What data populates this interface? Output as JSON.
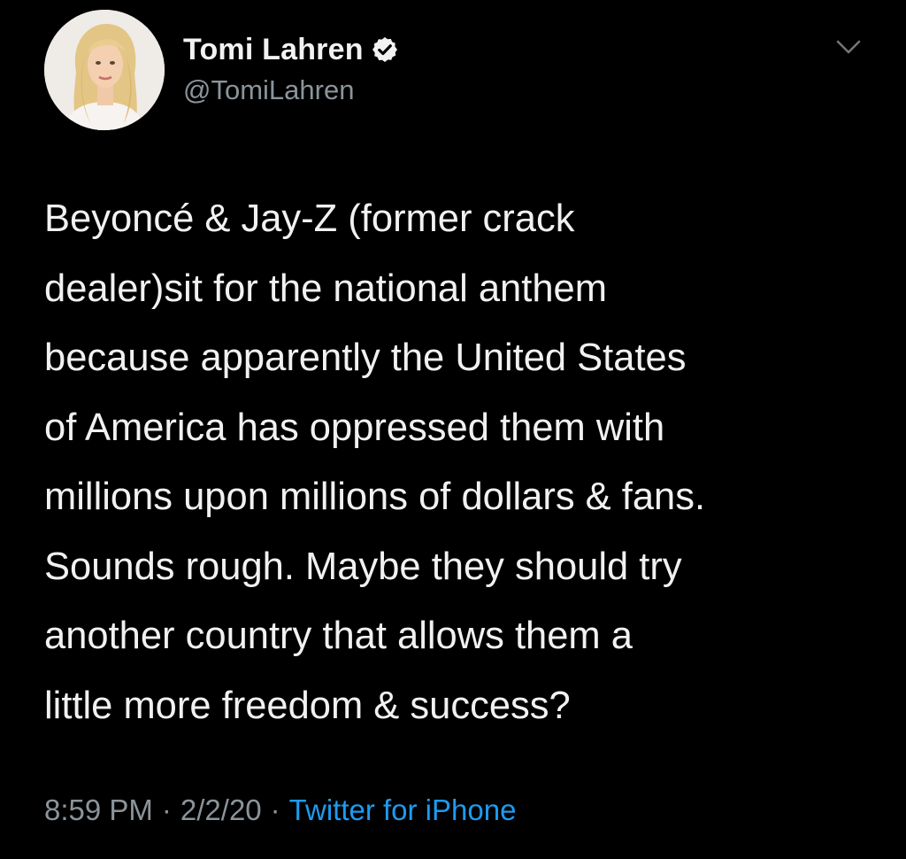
{
  "tweet": {
    "author": {
      "name": "Tomi Lahren",
      "handle": "@TomiLahren",
      "verified": true
    },
    "icons": {
      "verified": "verified-badge-icon",
      "menu": "chevron-down-icon"
    },
    "text_lines": [
      "Beyoncé & Jay-Z (former crack",
      "dealer)sit for the national anthem",
      "because apparently the United States",
      "of America has oppressed them with",
      "millions upon millions of dollars & fans.",
      "Sounds rough. Maybe they should try",
      "another country that allows them a",
      "little more freedom & success?"
    ],
    "meta": {
      "time": "8:59 PM",
      "separator": "·",
      "date": "2/2/20",
      "source": "Twitter for iPhone"
    }
  },
  "colors": {
    "background": "#000000",
    "text": "#f1f1f1",
    "secondary_text": "#8b949a",
    "link": "#1d9bf0"
  }
}
